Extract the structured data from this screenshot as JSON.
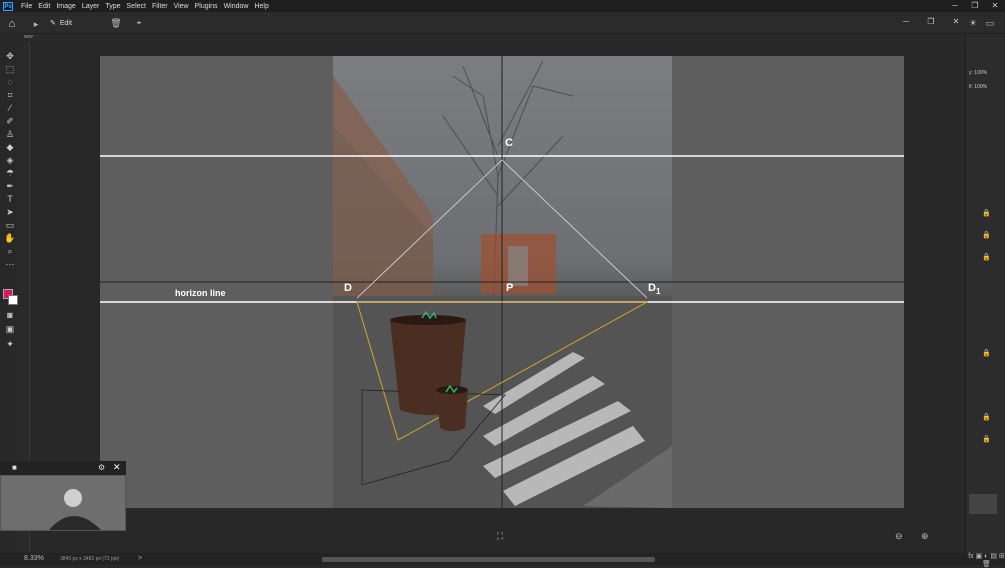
{
  "app": {
    "name": "Ps",
    "accent": "#31a8ff"
  },
  "menu": [
    "File",
    "Edit",
    "Image",
    "Layer",
    "Type",
    "Select",
    "Filter",
    "View",
    "Plugins",
    "Window",
    "Help"
  ],
  "window_controls": {
    "minimize": "─",
    "maximize": "❐",
    "close": "✕"
  },
  "options_bar": {
    "edit_label": "Edit",
    "home_icon": "home-icon",
    "delete_icon": "trash-icon",
    "mask_icon": "mask-icon"
  },
  "doc_tab": "wov",
  "canvas_labels": {
    "c": "C",
    "horizon": "horizon line",
    "d": "D",
    "p": "P",
    "d1": "D",
    "d1_sub": "1"
  },
  "status": {
    "zoom": "8.33%",
    "doc_size": "3840 px x 3482 px (72 ppi)",
    "arrow": ">"
  },
  "right_panel": {
    "pct1_label": "y:",
    "pct1": "100%",
    "pct2_label": "fi:",
    "pct2": "100%"
  },
  "colors": {
    "foreground": "#e0115f",
    "background": "#ffffff",
    "guide_yellow": "#d4a52a"
  }
}
